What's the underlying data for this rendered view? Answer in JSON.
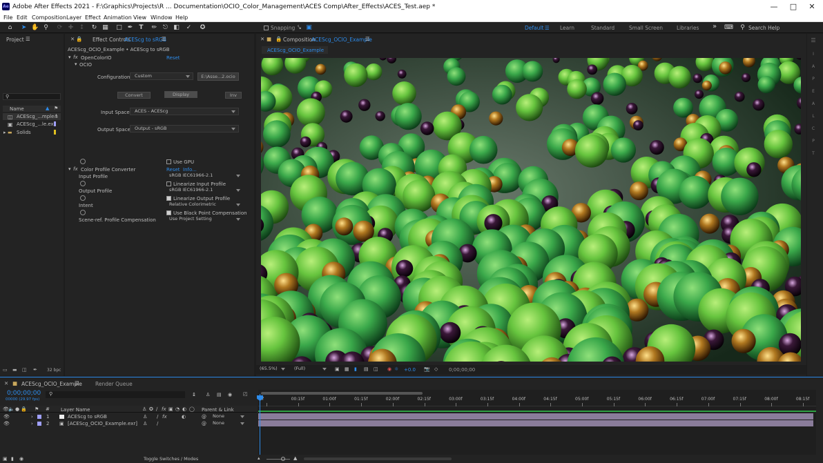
{
  "window": {
    "title": "Adobe After Effects 2021 - F:\\Graphics\\Projects\\R ... Documentation\\OCIO_Color_Management\\ACES Comp\\After_Effects\\ACES_Test.aep *",
    "icon_text": "Ae"
  },
  "menu": [
    "File",
    "Edit",
    "Composition",
    "Layer",
    "Effect",
    "Animation",
    "View",
    "Window",
    "Help"
  ],
  "toolbar": {
    "snapping": "Snapping",
    "workspaces": [
      "Default",
      "Learn",
      "Standard",
      "Small Screen",
      "Libraries"
    ],
    "more": "»",
    "search_placeholder": "Search Help"
  },
  "project": {
    "tab": "Project",
    "col_name": "Name",
    "items": [
      {
        "name": "ACEScg_...mple",
        "color": "#a0a0ff"
      },
      {
        "name": "ACEScg_...le.exr",
        "color": "#a0a0ff"
      },
      {
        "name": "Solids",
        "color": "#e0c020"
      }
    ],
    "bpc": "32 bpc"
  },
  "effect_controls": {
    "tab_prefix": "Effect Controls",
    "tab_layer": "ACEScg to sRGB",
    "header": "ACEScg_OCIO_Example • ACEScg to sRGB",
    "ocio": {
      "name": "OpenColorIO",
      "reset": "Reset",
      "sub": "OCIO",
      "config_label": "Configuration:",
      "config_value": "Custom",
      "config_file": "E:\\Asse...2.ocio",
      "convert": "Convert",
      "display": "Display",
      "inv": "Inv",
      "input_label": "Input Space:",
      "input_value": "ACES - ACEScg",
      "output_label": "Output Space:",
      "output_value": "Output - sRGB",
      "gpu": "Use GPU"
    },
    "cpc": {
      "name": "Color Profile Converter",
      "reset": "Reset",
      "info": "Info...",
      "input_label": "Input Profile",
      "input_value": "sRGB IEC61966-2.1",
      "lin_in": "Linearize Input Profile",
      "output_label": "Output Profile",
      "output_value": "sRGB IEC61966-2.1",
      "lin_out": "Linearize Output Profile",
      "intent_label": "Intent",
      "intent_value": "Relative Colorimetric",
      "bpc": "Use Black Point Compensation",
      "scene_label": "Scene-ref. Profile Compensation",
      "scene_value": "Use Project Setting"
    }
  },
  "composition": {
    "tab_prefix": "Composition",
    "tab_name": "ACEScg_OCIO_Example",
    "subtab": "ACEScg_OCIO_Example",
    "zoom": "(65.5%)",
    "quality": "(Full)",
    "exposure": "+0.0",
    "timecode": "0;00;00;00"
  },
  "timeline": {
    "tab": "ACEScg_OCIO_Example",
    "render_queue": "Render Queue",
    "timecode": "0;00;00;00",
    "fps": "00000 (29.97 fps)",
    "col_layer": "Layer Name",
    "col_parent": "Parent & Link",
    "ruler": [
      "0f",
      "00:15f",
      "01:00f",
      "01:15f",
      "02:00f",
      "02:15f",
      "03:00f",
      "03:15f",
      "04:00f",
      "04:15f",
      "05:00f",
      "05:15f",
      "06:00f",
      "06:15f",
      "07:00f",
      "07:15f",
      "08:00f",
      "08:15f"
    ],
    "layers": [
      {
        "num": "1",
        "name": "ACEScg to sRGB",
        "parent": "None"
      },
      {
        "num": "2",
        "name": "[ACEScg_OCIO_Example.exr]",
        "parent": "None"
      }
    ],
    "toggle": "Toggle Switches / Modes"
  }
}
